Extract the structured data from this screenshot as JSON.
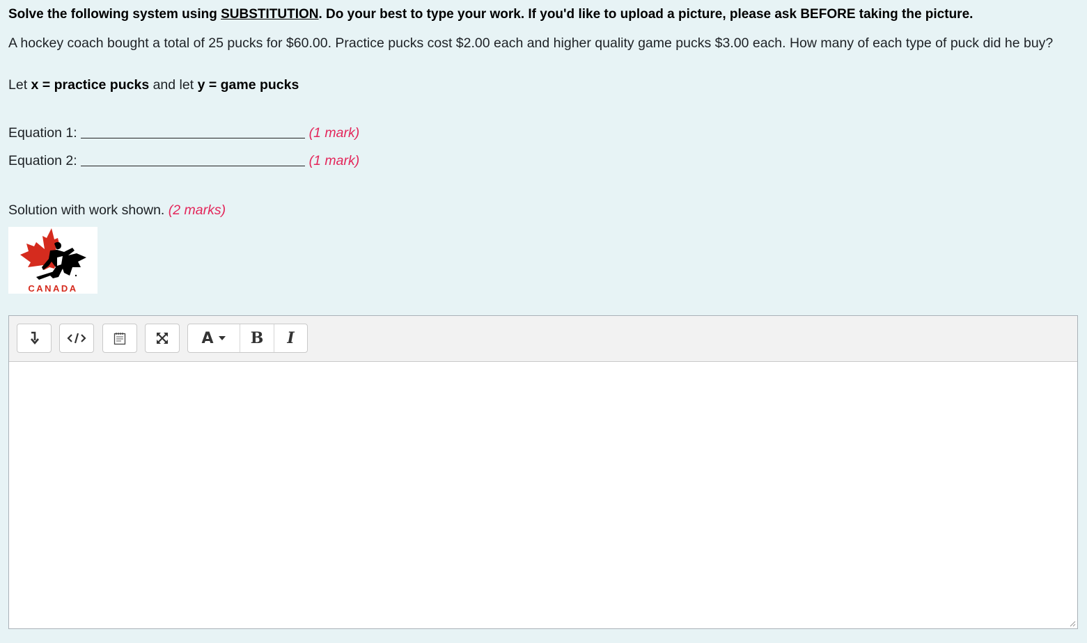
{
  "question": {
    "instruction_pre": "Solve the following system using ",
    "instruction_method": "SUBSTITUTION",
    "instruction_post": ". Do your best to type your work. If you'd like to upload a picture, please ask BEFORE taking the picture.",
    "problem_text": "A hockey coach bought a total of 25 pucks for $60.00. Practice pucks cost $2.00 each and higher quality game pucks $3.00 each. How many of each type of puck did he buy?",
    "let_prefix": "Let ",
    "let_x": "x = practice pucks",
    "let_mid": " and let ",
    "let_y": "y = game pucks"
  },
  "equations": [
    {
      "label": "Equation 1:",
      "marks": "(1 mark)"
    },
    {
      "label": "Equation 2:",
      "marks": "(1 mark)"
    }
  ],
  "solution": {
    "label": "Solution with work shown.",
    "marks": "(2 marks)"
  },
  "logo": {
    "text": "CANADA",
    "leaf_color": "#d52b1e",
    "player_color": "#000000"
  },
  "editor": {
    "toolbar": [
      {
        "name": "expand-toolbar-icon"
      },
      {
        "name": "html-code-icon"
      },
      {
        "name": "autosave-notes-icon"
      },
      {
        "name": "fullscreen-icon"
      },
      {
        "name": "font-color-icon",
        "label": "A"
      },
      {
        "name": "bold-icon",
        "label": "B"
      },
      {
        "name": "italic-icon",
        "label": "I"
      }
    ],
    "content": ""
  },
  "colors": {
    "page_bg": "#e7f3f5",
    "marks": "#e3265a",
    "toolbar_bg": "#f2f2f2"
  }
}
